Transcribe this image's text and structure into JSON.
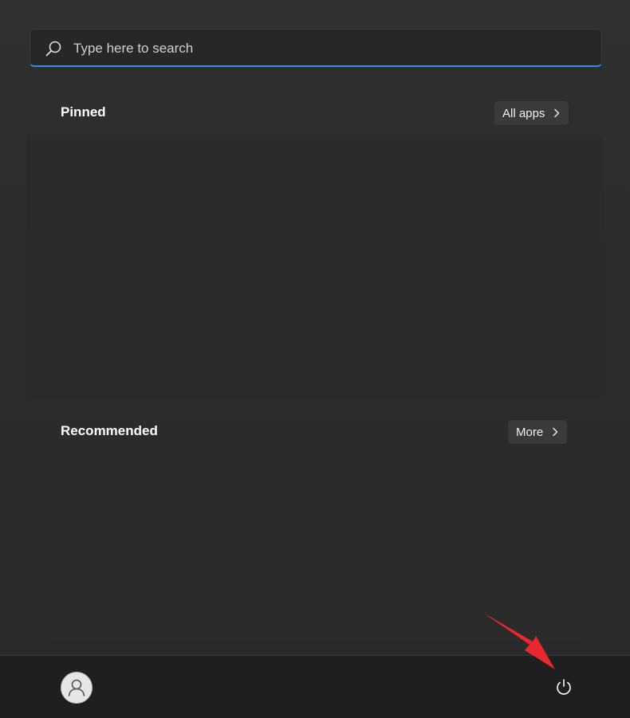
{
  "search": {
    "placeholder": "Type here to search",
    "icon": "search-icon"
  },
  "pinned": {
    "title": "Pinned",
    "all_apps_label": "All apps"
  },
  "recommended": {
    "title": "Recommended",
    "more_label": "More"
  },
  "footer": {
    "avatar_icon": "user-icon",
    "power_icon": "power-icon"
  },
  "colors": {
    "accent": "#3a8de0",
    "annotation_arrow": "#e8282e",
    "background": "#2c2c2c",
    "footer_background": "#1f1f1f"
  }
}
